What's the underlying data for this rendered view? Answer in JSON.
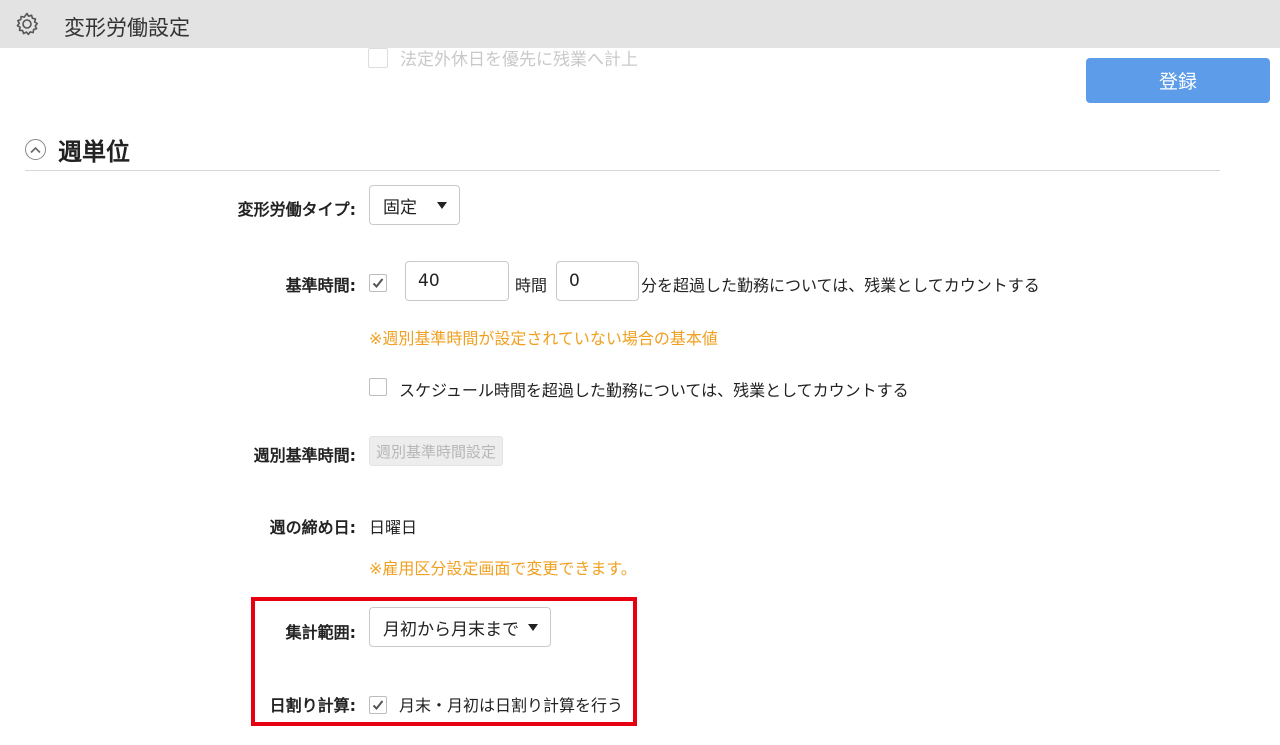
{
  "header": {
    "title": "変形労働設定",
    "icon": "gear-icon"
  },
  "ghost_option": {
    "label": "法定外休日を優先に残業へ計上"
  },
  "register_button": {
    "label": "登録",
    "color": "#5c9ce8"
  },
  "section": {
    "title": "週単位"
  },
  "fields": {
    "type": {
      "label": "変形労働タイプ:",
      "value": "固定"
    },
    "base_time": {
      "label": "基準時間:",
      "checked": true,
      "hours": "40",
      "hours_unit": "時間",
      "minutes": "0",
      "suffix": "分を超過した勤務については、残業としてカウントする",
      "note": "※週別基準時間が設定されていない場合の基本値",
      "schedule_option": {
        "checked": false,
        "label": "スケジュール時間を超過した勤務については、残業としてカウントする"
      }
    },
    "weekly_base_time": {
      "label": "週別基準時間:",
      "button": "週別基準時間設定"
    },
    "closing_day": {
      "label": "週の締め日:",
      "value": "日曜日",
      "note": "※雇用区分設定画面で変更できます。"
    },
    "aggregation_range": {
      "label": "集計範囲:",
      "value": "月初から月末まで"
    },
    "daily_proration": {
      "label": "日割り計算:",
      "checked": true,
      "option": "月末・月初は日割り計算を行う"
    }
  },
  "colors": {
    "note": "#f0a020",
    "highlight": "#e60012",
    "titlebar": "#e3e3e3"
  }
}
